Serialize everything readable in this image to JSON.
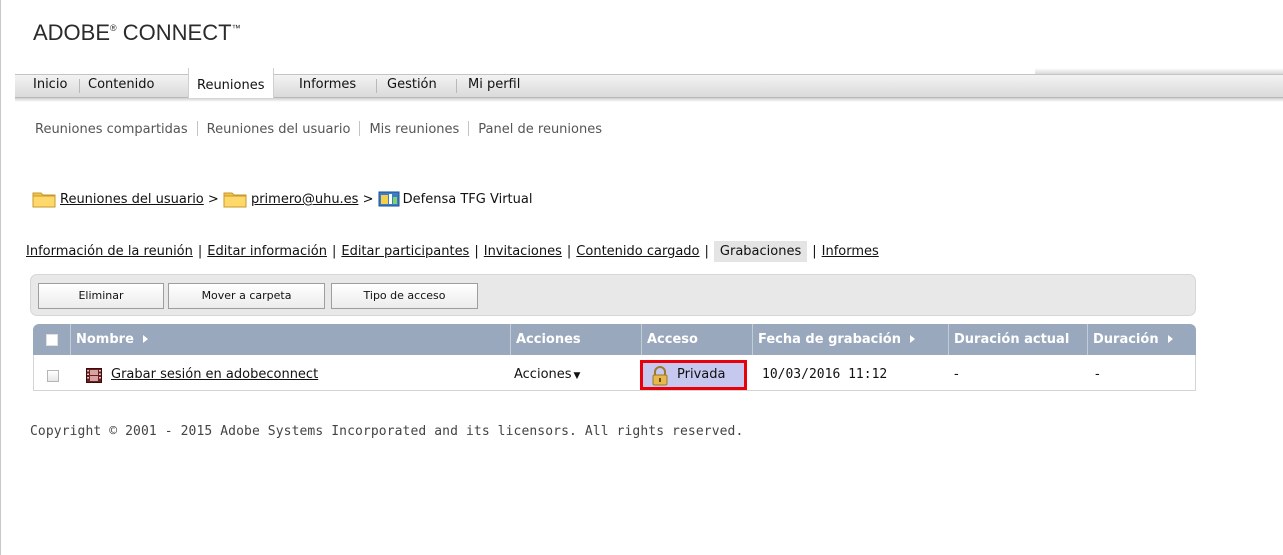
{
  "app": {
    "brand_main": "ADOBE",
    "brand_reg": "®",
    "brand_second": " CONNECT",
    "brand_tm": "™"
  },
  "topnav": {
    "items": [
      "Inicio",
      "Contenido",
      "Reuniones",
      "Informes",
      "Gestión",
      "Mi perfil"
    ],
    "active": "Reuniones"
  },
  "subnav": {
    "items": [
      "Reuniones compartidas",
      "Reuniones del usuario",
      "Mis reuniones",
      "Panel de reuniones"
    ]
  },
  "breadcrumb": {
    "items": [
      "Reuniones del usuario",
      "primero@uhu.es",
      "Defensa TFG Virtual"
    ],
    "separator": ">"
  },
  "tabs": {
    "items": [
      "Información de la reunión",
      "Editar información",
      "Editar participantes",
      "Invitaciones",
      "Contenido cargado",
      "Grabaciones",
      "Informes"
    ],
    "active": "Grabaciones"
  },
  "toolbar": {
    "buttons": [
      "Eliminar",
      "Mover a carpeta",
      "Tipo de acceso"
    ]
  },
  "table": {
    "headers": [
      "Nombre",
      "Acciones",
      "Acceso",
      "Fecha de grabación",
      "Duración actual",
      "Duración"
    ],
    "rows": [
      {
        "name": "Grabar sesión en adobeconnect",
        "actions": "Acciones",
        "access": "Privada",
        "date": "10/03/2016 11:12",
        "current_duration": "-",
        "duration": "-"
      }
    ]
  },
  "footer": {
    "copyright": "Copyright © 2001 - 2015 Adobe Systems Incorporated and its licensors. All rights reserved."
  },
  "colors": {
    "header_bg": "#9aa8bd",
    "access_highlight_bg": "#c6c8f0",
    "access_highlight_border": "#e8000b",
    "toolbar_bg": "#e8e8e8"
  }
}
